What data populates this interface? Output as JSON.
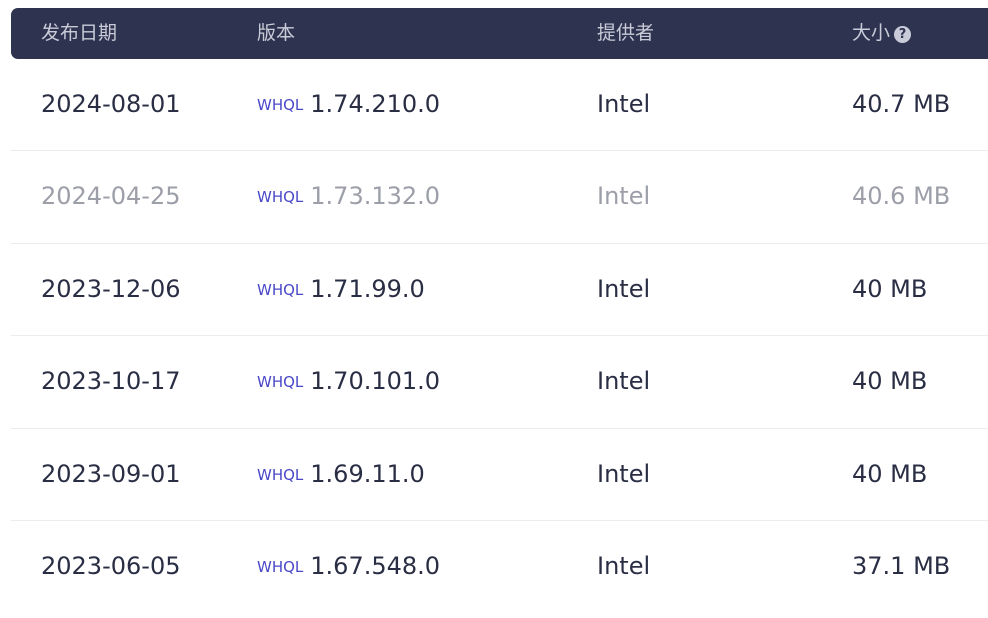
{
  "header": {
    "date": "发布日期",
    "version": "版本",
    "provider": "提供者",
    "size": "大小",
    "help_icon": "question-circle-icon"
  },
  "rows": [
    {
      "date": "2024-08-01",
      "badge": "WHQL",
      "version": "1.74.210.0",
      "provider": "Intel",
      "size": "40.7 MB"
    },
    {
      "date": "2024-04-25",
      "badge": "WHQL",
      "version": "1.73.132.0",
      "provider": "Intel",
      "size": "40.6 MB"
    },
    {
      "date": "2023-12-06",
      "badge": "WHQL",
      "version": "1.71.99.0",
      "provider": "Intel",
      "size": "40 MB"
    },
    {
      "date": "2023-10-17",
      "badge": "WHQL",
      "version": "1.70.101.0",
      "provider": "Intel",
      "size": "40 MB"
    },
    {
      "date": "2023-09-01",
      "badge": "WHQL",
      "version": "1.69.11.0",
      "provider": "Intel",
      "size": "40 MB"
    },
    {
      "date": "2023-06-05",
      "badge": "WHQL",
      "version": "1.67.548.0",
      "provider": "Intel",
      "size": "37.1 MB"
    }
  ],
  "colors": {
    "header_bg": "#2e3450",
    "header_text": "#c9ccd8",
    "row_text": "#2a2e44",
    "faded_text": "#9c9ea8",
    "whql": "#4a48c8"
  }
}
